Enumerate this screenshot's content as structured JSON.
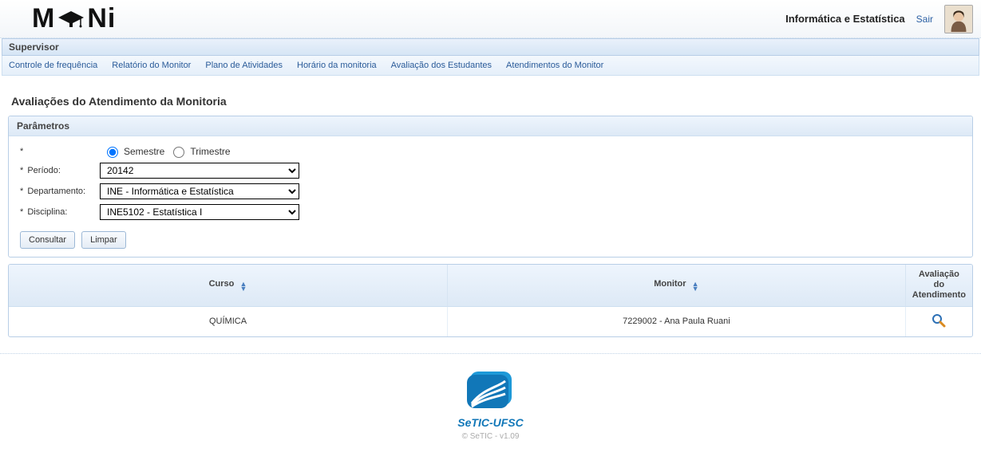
{
  "header": {
    "logo_text_1": "M",
    "logo_text_2": "Ni",
    "department": "Informática e Estatística",
    "logout": "Sair"
  },
  "role": "Supervisor",
  "menu": [
    "Controle de frequência",
    "Relatório do Monitor",
    "Plano de Atividades",
    "Horário da monitoria",
    "Avaliação dos Estudantes",
    "Atendimentos do Monitor"
  ],
  "page_title": "Avaliações do Atendimento da Monitoria",
  "params": {
    "panel_title": "Parâmetros",
    "required_mark": "*",
    "period_type": {
      "semestre": "Semestre",
      "trimestre": "Trimestre",
      "selected": "semestre"
    },
    "periodo": {
      "label": "Período:",
      "value": "20142"
    },
    "departamento": {
      "label": "Departamento:",
      "value": "INE - Informática e Estatística"
    },
    "disciplina": {
      "label": "Disciplina:",
      "value": "INE5102 - Estatística I"
    },
    "consultar": "Consultar",
    "limpar": "Limpar"
  },
  "table": {
    "cols": {
      "curso": "Curso",
      "monitor": "Monitor",
      "avaliacao": "Avaliação do Atendimento"
    },
    "rows": [
      {
        "curso": "QUÍMICA",
        "monitor": "7229002 - Ana Paula Ruani"
      }
    ]
  },
  "footer": {
    "brand": "SeTIC-UFSC",
    "copy": "© SeTIC - v1.09"
  }
}
